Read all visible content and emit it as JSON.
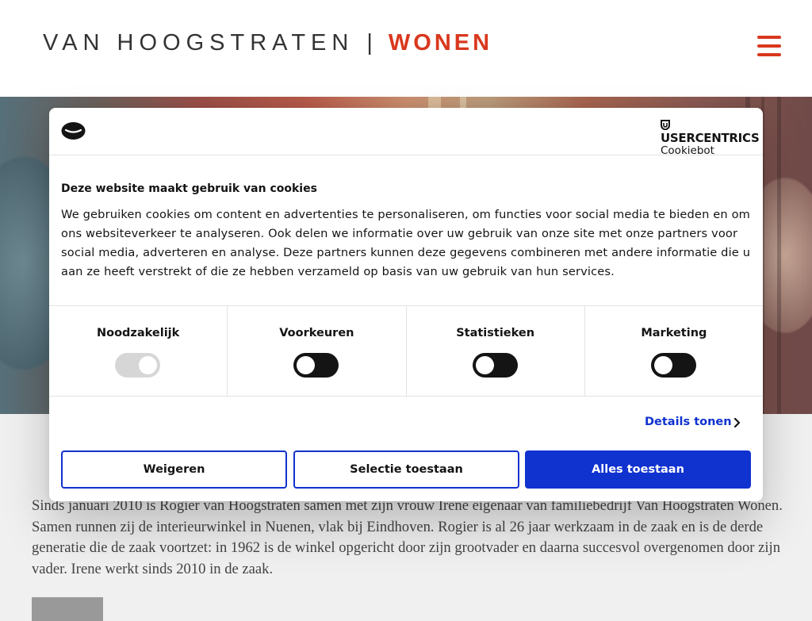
{
  "header": {
    "logo_main": "VAN HOOGSTRATEN",
    "logo_separator": "|",
    "logo_sub": "WONEN",
    "brand_color": "#d9381e",
    "menu_icon": "hamburger-menu-icon"
  },
  "intro_text": "Sinds januari 2010 is Rogier van Hoogstraten samen met zijn vrouw Irene eigenaar van familiebedrijf Van Hoogstraten Wonen. Samen runnen zij de interieurwinkel in Nuenen, vlak bij Eindhoven. Rogier is al 26 jaar werkzaam in de zaak en is de derde generatie die de zaak voortzet: in 1962 is de winkel opgericht door zijn grootvader en daarna succesvol overgenomen door zijn vader. Irene werkt sinds 2010 in de zaak.",
  "cookie_dialog": {
    "provider_name": "USERCENTRICS",
    "provider_sub": "Cookiebot",
    "title": "Deze website maakt gebruik van cookies",
    "text": "We gebruiken cookies om content en advertenties te personaliseren, om functies voor social media te bieden en om ons websiteverkeer te analyseren. Ook delen we informatie over uw gebruik van onze site met onze partners voor social media, adverteren en analyse. Deze partners kunnen deze gegevens combineren met andere informatie die u aan ze heeft verstrekt of die ze hebben verzameld op basis van uw gebruik van hun services.",
    "categories": [
      {
        "label": "Noodzakelijk",
        "enabled": true,
        "locked": true
      },
      {
        "label": "Voorkeuren",
        "enabled": false,
        "locked": false
      },
      {
        "label": "Statistieken",
        "enabled": false,
        "locked": false
      },
      {
        "label": "Marketing",
        "enabled": false,
        "locked": false
      }
    ],
    "details_label": "Details tonen",
    "buttons": {
      "deny": "Weigeren",
      "allow_selection": "Selectie toestaan",
      "allow_all": "Alles toestaan"
    },
    "accent_color": "#1032cf"
  }
}
